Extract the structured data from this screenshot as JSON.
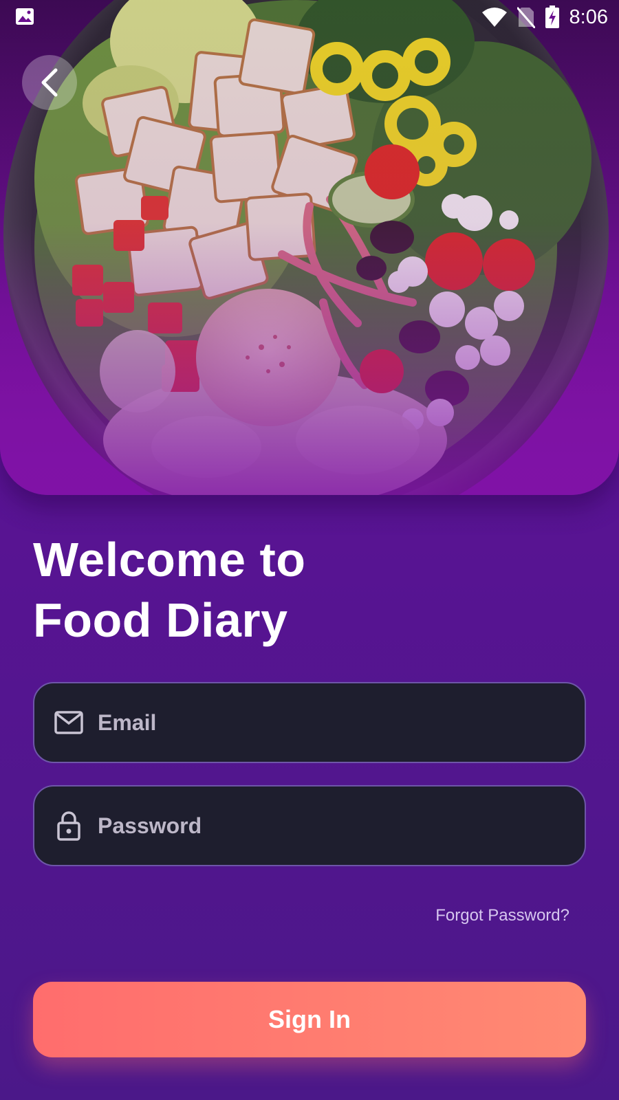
{
  "status_bar": {
    "time": "8:06",
    "icons": [
      "image-icon",
      "wifi-icon",
      "no-sim-icon",
      "battery-charging-icon"
    ]
  },
  "navigation": {
    "back_icon": "chevron-left-icon"
  },
  "hero": {
    "image_subject": "salad bowl"
  },
  "welcome": {
    "line1": "Welcome to",
    "line2": "Food Diary"
  },
  "form": {
    "email": {
      "placeholder": "Email",
      "value": "",
      "icon": "mail-icon"
    },
    "password": {
      "placeholder": "Password",
      "value": "",
      "icon": "lock-icon"
    },
    "forgot_password": "Forgot Password?",
    "sign_in": "Sign In"
  },
  "colors": {
    "background_top": "#6a0f9a",
    "background_bottom": "#4b1889",
    "field_background": "#1e1e2e",
    "field_border": "#6e56a8",
    "button_gradient_start": "#ff6d6d",
    "button_gradient_end": "#ff8a73",
    "forgot_link": "#d6c6ef"
  }
}
